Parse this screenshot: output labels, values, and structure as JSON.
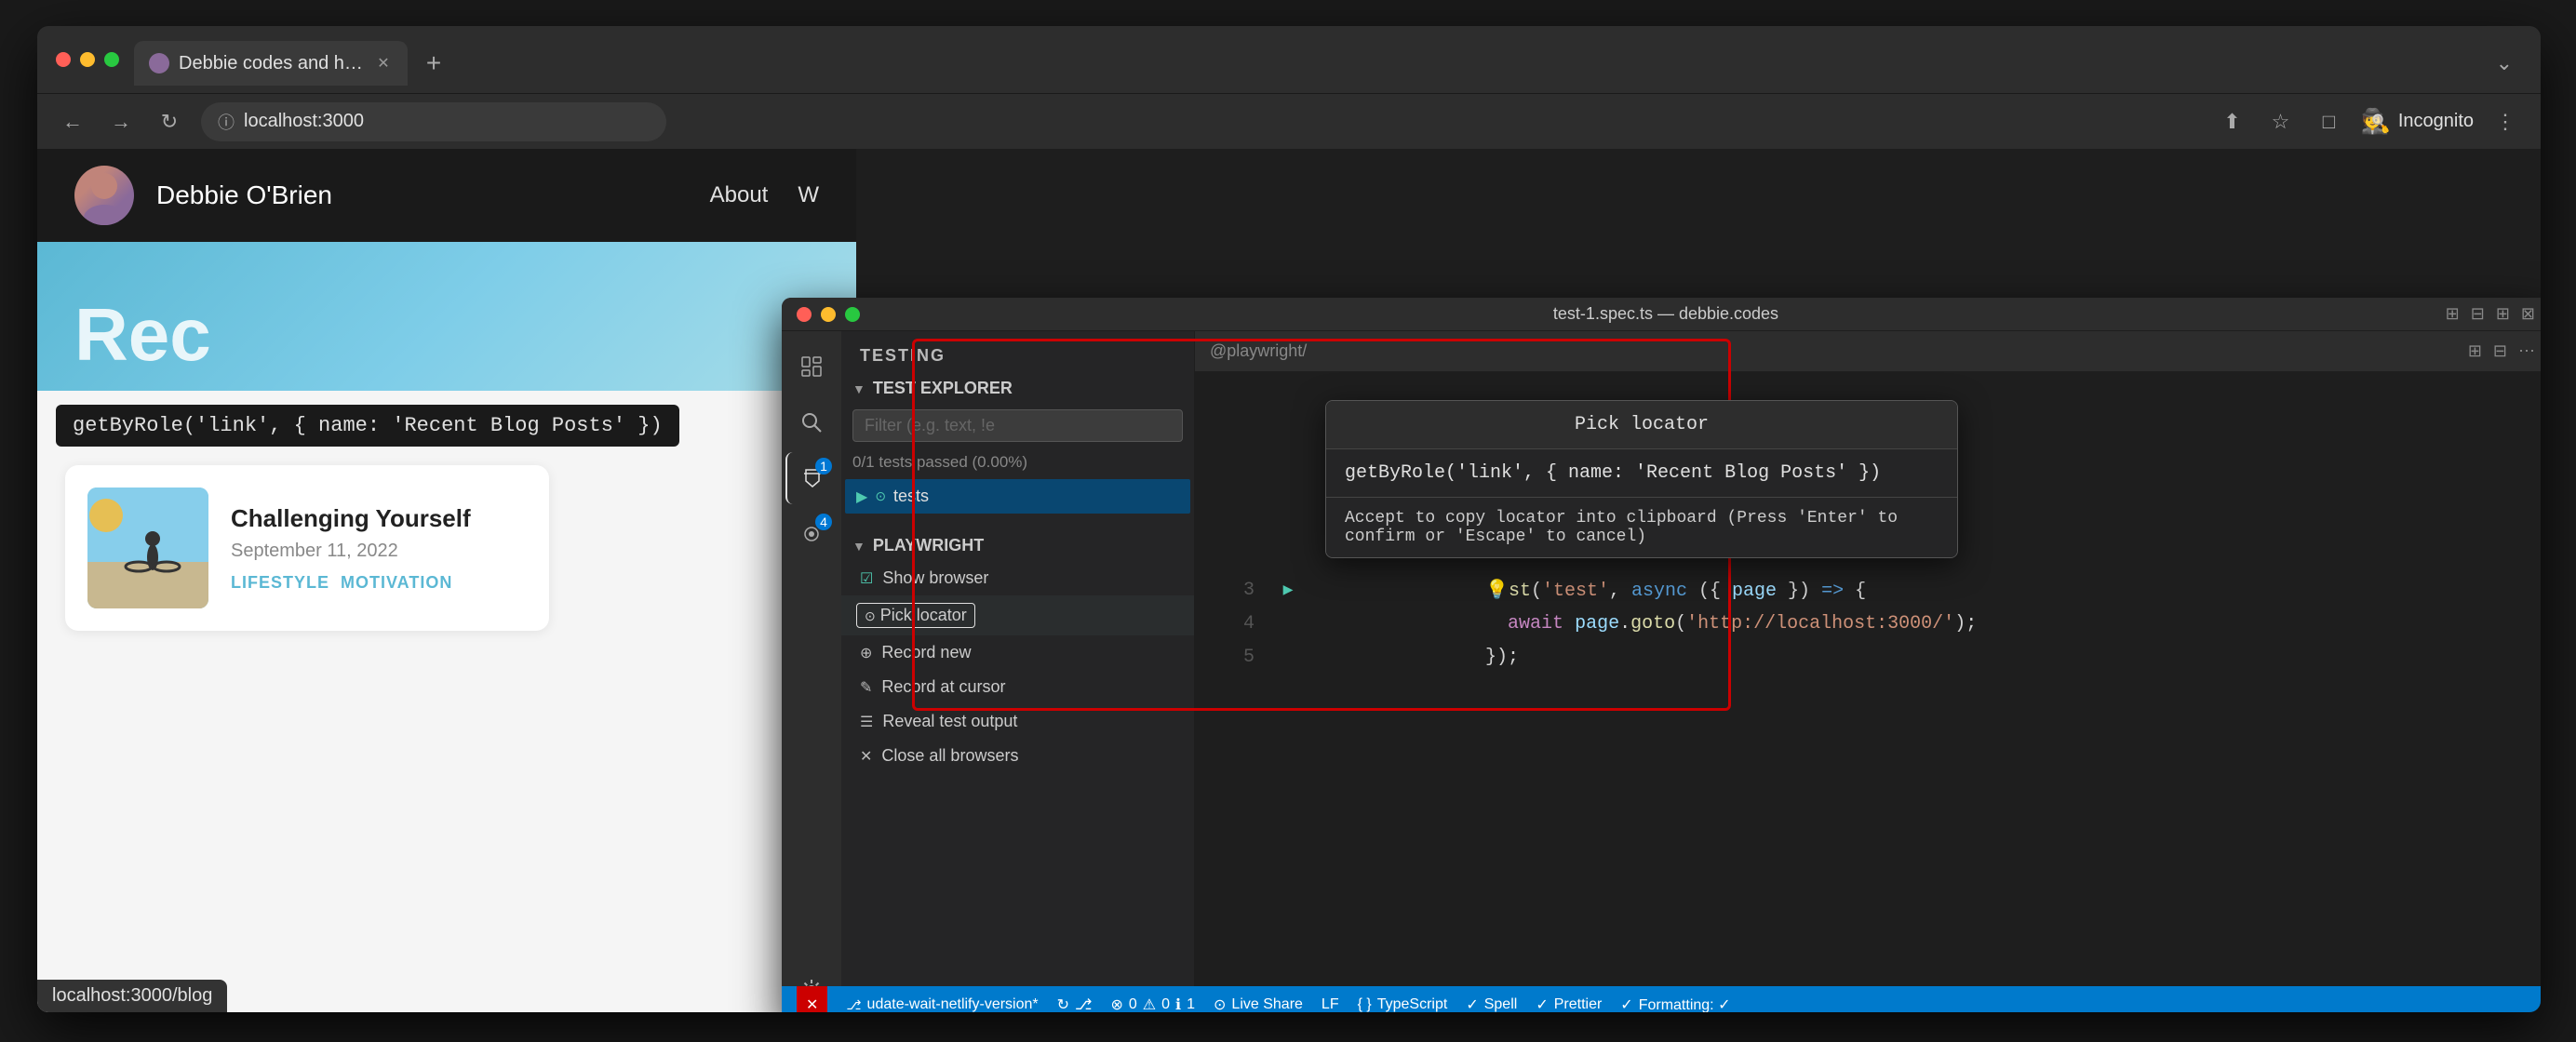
{
  "browser": {
    "tab_title": "Debbie codes and helps others",
    "tab_url": "localhost:3000",
    "nav_buttons": [
      "←",
      "→",
      "↻"
    ],
    "incognito_label": "Incognito"
  },
  "website": {
    "author": "Debbie O'Brien",
    "nav_items": [
      "About",
      "W"
    ],
    "hero_title": "Rec",
    "locator_badge": "getByRole('link', { name: 'Recent Blog Posts' })",
    "blog_card": {
      "title": "Challenging Yourself",
      "date": "September 11, 2022",
      "tags": [
        "LIFESTYLE",
        "MOTIVATION"
      ]
    },
    "statusbar": "localhost:3000/blog"
  },
  "vscode": {
    "titlebar": "test-1.spec.ts — debbie.codes",
    "testing_label": "TESTING",
    "test_explorer_label": "TEST EXPLORER",
    "filter_placeholder": "Filter (e.g. text, !e",
    "test_status": "0/1 tests passed (0.00%)",
    "test_item": "tests",
    "playwright_label": "PLAYWRIGHT",
    "playwright_items": [
      {
        "label": "Show browser",
        "type": "checkbox",
        "checked": true
      },
      {
        "label": "Pick locator",
        "type": "button",
        "highlighted": true
      },
      {
        "label": "Record new",
        "type": "record"
      },
      {
        "label": "Record at cursor",
        "type": "cursor"
      },
      {
        "label": "Reveal test output",
        "type": "reveal"
      },
      {
        "label": "Close all browsers",
        "type": "close"
      }
    ],
    "code_lines": [
      {
        "num": "3",
        "text": "st('test', async ({ page }) => {",
        "has_run_btn": true
      },
      {
        "num": "4",
        "text": "  await page.goto('http://localhost:3000/');"
      },
      {
        "num": "5",
        "text": "});"
      }
    ],
    "statusbar": {
      "branch": "udate-wait-netlify-version*",
      "sync": "",
      "errors": "0",
      "warnings": "0",
      "info": "1",
      "liveshare": "Live Share",
      "lf": "LF",
      "typescript": "TypeScript",
      "spell": "Spell",
      "prettier": "Prettier",
      "formatting": "Formatting: ✓"
    },
    "pick_locator_overlay": {
      "title": "Pick locator",
      "locator_text": "getByRole('link', { name: 'Recent Blog Posts' })",
      "hint": "Accept to copy locator into clipboard (Press 'Enter' to confirm or 'Escape' to cancel)"
    }
  }
}
